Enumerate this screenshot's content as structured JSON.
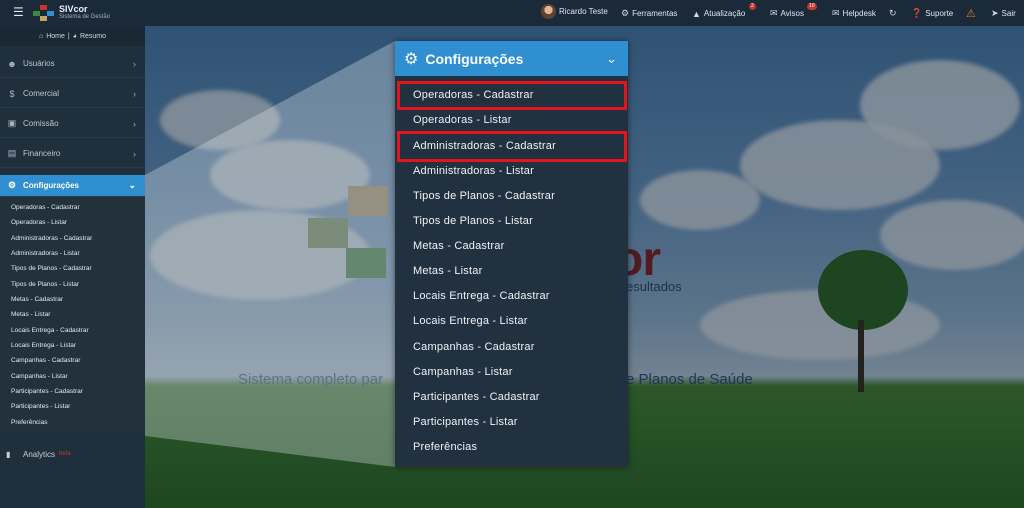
{
  "topbar": {
    "app_title": "SIVcor",
    "app_subtitle": "Sistema de Gestão",
    "user_name": "Ricardo Teste",
    "tools_label": "Ferramentas",
    "updates_label": "Atualização",
    "updates_badge": "2",
    "notices_label": "Avisos",
    "notices_badge": "10",
    "helpdesk_label": "Helpdesk",
    "support_label": "Suporte",
    "exit_label": "Sair"
  },
  "sidebar": {
    "home_label": "Home",
    "separator": "|",
    "summary_label": "Resumo",
    "items": [
      {
        "label": "Usuários",
        "icon": "users-icon"
      },
      {
        "label": "Comercial",
        "icon": "dollar-icon"
      },
      {
        "label": "Comissão",
        "icon": "money-icon"
      },
      {
        "label": "Financeiro",
        "icon": "bank-icon"
      }
    ],
    "config_label": "Configurações",
    "submenu": [
      "Operadoras - Cadastrar",
      "Operadoras - Listar",
      "Administradoras - Cadastrar",
      "Administradoras - Listar",
      "Tipos de Planos - Cadastrar",
      "Tipos de Planos - Listar",
      "Metas - Cadastrar",
      "Metas - Listar",
      "Locais Entrega - Cadastrar",
      "Locais Entrega - Listar",
      "Campanhas - Cadastrar",
      "Campanhas - Listar",
      "Participantes - Cadastrar",
      "Participantes - Listar",
      "Preferências"
    ],
    "analytics_label": "Analytics",
    "analytics_badge": "beta"
  },
  "zoom": {
    "title": "Configurações",
    "items": [
      "Operadoras - Cadastrar",
      "Operadoras - Listar",
      "Administradoras - Cadastrar",
      "Administradoras - Listar",
      "Tipos de Planos - Cadastrar",
      "Tipos de Planos - Listar",
      "Metas - Cadastrar",
      "Metas - Listar",
      "Locais Entrega - Cadastrar",
      "Locais Entrega - Listar",
      "Campanhas - Cadastrar",
      "Campanhas - Listar",
      "Participantes - Cadastrar",
      "Participantes - Listar",
      "Preferências"
    ],
    "highlighted": [
      "Operadoras - Cadastrar",
      "Administradoras - Cadastrar"
    ],
    "highlight_color": "#e3141e"
  },
  "background": {
    "brand_partial": "or",
    "brand_sub_partial": "esultados",
    "tagline_left": "Sistema completo par",
    "tagline_right": "e Planos de Saúde"
  },
  "colors": {
    "accent": "#2f8fd0",
    "topbar": "#1b2a38",
    "sidebar": "#1f2f3c",
    "brand": "#8e1e1e"
  }
}
